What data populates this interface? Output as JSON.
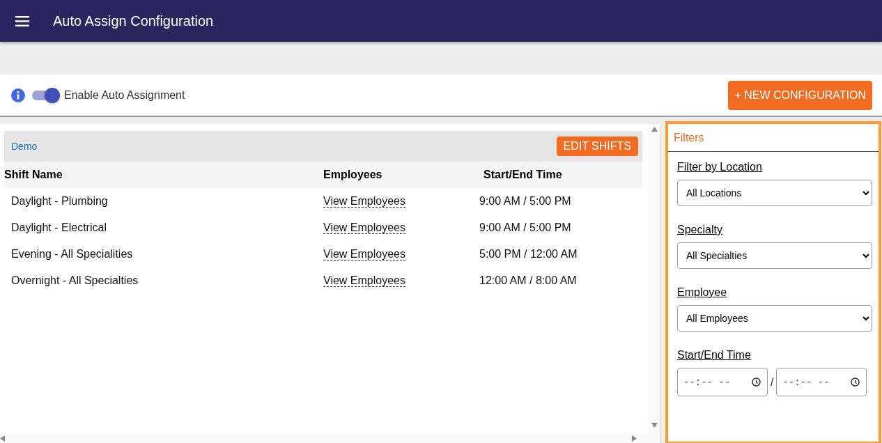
{
  "app_bar": {
    "title": "Auto Assign Configuration"
  },
  "toolbar": {
    "auto_assign": {
      "label": "Enable Auto Assignment",
      "on": true
    },
    "new_button": "+ NEW CONFIGURATION"
  },
  "configuration": {
    "name": "Demo",
    "edit_button": "EDIT SHIFTS",
    "columns": [
      "Shift Name",
      "Employees",
      "Start/End Time"
    ],
    "rows": [
      {
        "shift": "Daylight - Plumbing",
        "employees": "View Employees",
        "time": "9:00 AM / 5:00 PM"
      },
      {
        "shift": "Daylight - Electrical",
        "employees": "View Employees",
        "time": "9:00 AM / 5:00 PM"
      },
      {
        "shift": "Evening - All Specialities",
        "employees": "View Employees",
        "time": "5:00 PM / 12:00 AM"
      },
      {
        "shift": "Overnight - All Specialties",
        "employees": "View Employees",
        "time": "12:00 AM / 8:00 AM"
      }
    ]
  },
  "filters": {
    "title": "Filters",
    "selects": [
      {
        "label": "Filter by Location",
        "value": "All Locations"
      },
      {
        "label": "Specialty",
        "value": "All Specialties"
      },
      {
        "label": "Employee",
        "value": "All Employees"
      }
    ],
    "time": {
      "label": "Start/End Time",
      "start_placeholder": "--:-- --",
      "separator": "/",
      "end_placeholder": "--:-- --"
    }
  }
}
